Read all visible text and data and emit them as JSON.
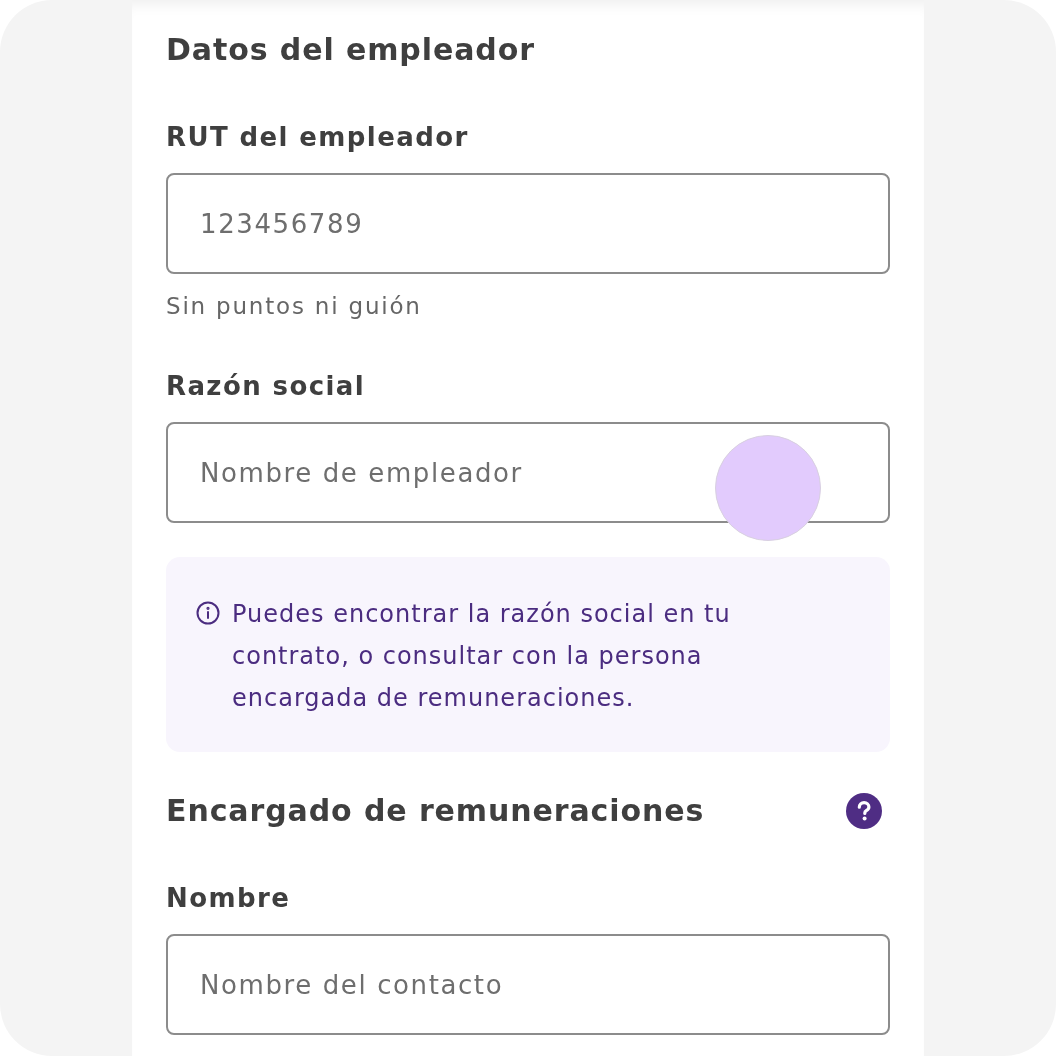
{
  "sections": [
    {
      "title": "Datos del empleador",
      "fields": [
        {
          "label": "RUT del empleador",
          "placeholder": "123456789",
          "hint": "Sin puntos ni guión"
        },
        {
          "label": "Razón social",
          "placeholder": "Nombre de empleador",
          "touch_indicator": true
        }
      ],
      "info_note": "Puedes encontrar la razón social en tu contrato, o consultar con la persona encargada de remuneraciones."
    },
    {
      "title": "Encargado de remuneraciones",
      "help": true,
      "fields": [
        {
          "label": "Nombre",
          "placeholder": "Nombre del contacto"
        }
      ]
    }
  ]
}
